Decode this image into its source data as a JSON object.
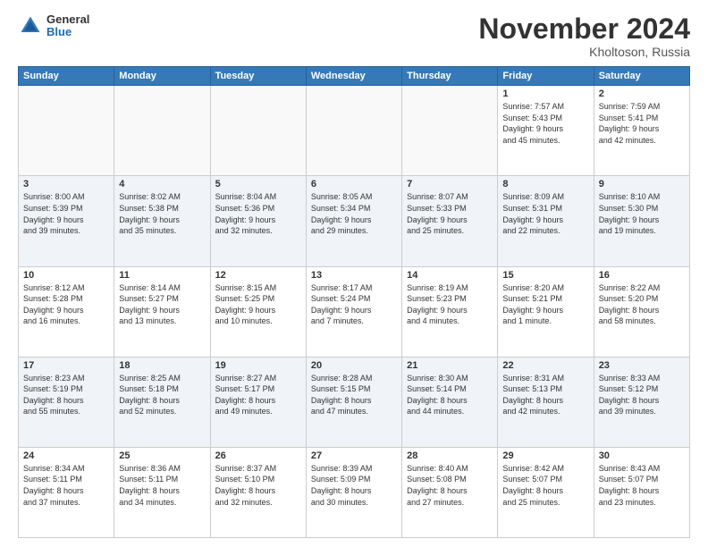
{
  "header": {
    "logo": {
      "general": "General",
      "blue": "Blue"
    },
    "title": "November 2024",
    "subtitle": "Kholtoson, Russia"
  },
  "weekdays": [
    "Sunday",
    "Monday",
    "Tuesday",
    "Wednesday",
    "Thursday",
    "Friday",
    "Saturday"
  ],
  "weeks": [
    [
      {
        "day": "",
        "info": ""
      },
      {
        "day": "",
        "info": ""
      },
      {
        "day": "",
        "info": ""
      },
      {
        "day": "",
        "info": ""
      },
      {
        "day": "",
        "info": ""
      },
      {
        "day": "1",
        "info": "Sunrise: 7:57 AM\nSunset: 5:43 PM\nDaylight: 9 hours\nand 45 minutes."
      },
      {
        "day": "2",
        "info": "Sunrise: 7:59 AM\nSunset: 5:41 PM\nDaylight: 9 hours\nand 42 minutes."
      }
    ],
    [
      {
        "day": "3",
        "info": "Sunrise: 8:00 AM\nSunset: 5:39 PM\nDaylight: 9 hours\nand 39 minutes."
      },
      {
        "day": "4",
        "info": "Sunrise: 8:02 AM\nSunset: 5:38 PM\nDaylight: 9 hours\nand 35 minutes."
      },
      {
        "day": "5",
        "info": "Sunrise: 8:04 AM\nSunset: 5:36 PM\nDaylight: 9 hours\nand 32 minutes."
      },
      {
        "day": "6",
        "info": "Sunrise: 8:05 AM\nSunset: 5:34 PM\nDaylight: 9 hours\nand 29 minutes."
      },
      {
        "day": "7",
        "info": "Sunrise: 8:07 AM\nSunset: 5:33 PM\nDaylight: 9 hours\nand 25 minutes."
      },
      {
        "day": "8",
        "info": "Sunrise: 8:09 AM\nSunset: 5:31 PM\nDaylight: 9 hours\nand 22 minutes."
      },
      {
        "day": "9",
        "info": "Sunrise: 8:10 AM\nSunset: 5:30 PM\nDaylight: 9 hours\nand 19 minutes."
      }
    ],
    [
      {
        "day": "10",
        "info": "Sunrise: 8:12 AM\nSunset: 5:28 PM\nDaylight: 9 hours\nand 16 minutes."
      },
      {
        "day": "11",
        "info": "Sunrise: 8:14 AM\nSunset: 5:27 PM\nDaylight: 9 hours\nand 13 minutes."
      },
      {
        "day": "12",
        "info": "Sunrise: 8:15 AM\nSunset: 5:25 PM\nDaylight: 9 hours\nand 10 minutes."
      },
      {
        "day": "13",
        "info": "Sunrise: 8:17 AM\nSunset: 5:24 PM\nDaylight: 9 hours\nand 7 minutes."
      },
      {
        "day": "14",
        "info": "Sunrise: 8:19 AM\nSunset: 5:23 PM\nDaylight: 9 hours\nand 4 minutes."
      },
      {
        "day": "15",
        "info": "Sunrise: 8:20 AM\nSunset: 5:21 PM\nDaylight: 9 hours\nand 1 minute."
      },
      {
        "day": "16",
        "info": "Sunrise: 8:22 AM\nSunset: 5:20 PM\nDaylight: 8 hours\nand 58 minutes."
      }
    ],
    [
      {
        "day": "17",
        "info": "Sunrise: 8:23 AM\nSunset: 5:19 PM\nDaylight: 8 hours\nand 55 minutes."
      },
      {
        "day": "18",
        "info": "Sunrise: 8:25 AM\nSunset: 5:18 PM\nDaylight: 8 hours\nand 52 minutes."
      },
      {
        "day": "19",
        "info": "Sunrise: 8:27 AM\nSunset: 5:17 PM\nDaylight: 8 hours\nand 49 minutes."
      },
      {
        "day": "20",
        "info": "Sunrise: 8:28 AM\nSunset: 5:15 PM\nDaylight: 8 hours\nand 47 minutes."
      },
      {
        "day": "21",
        "info": "Sunrise: 8:30 AM\nSunset: 5:14 PM\nDaylight: 8 hours\nand 44 minutes."
      },
      {
        "day": "22",
        "info": "Sunrise: 8:31 AM\nSunset: 5:13 PM\nDaylight: 8 hours\nand 42 minutes."
      },
      {
        "day": "23",
        "info": "Sunrise: 8:33 AM\nSunset: 5:12 PM\nDaylight: 8 hours\nand 39 minutes."
      }
    ],
    [
      {
        "day": "24",
        "info": "Sunrise: 8:34 AM\nSunset: 5:11 PM\nDaylight: 8 hours\nand 37 minutes."
      },
      {
        "day": "25",
        "info": "Sunrise: 8:36 AM\nSunset: 5:11 PM\nDaylight: 8 hours\nand 34 minutes."
      },
      {
        "day": "26",
        "info": "Sunrise: 8:37 AM\nSunset: 5:10 PM\nDaylight: 8 hours\nand 32 minutes."
      },
      {
        "day": "27",
        "info": "Sunrise: 8:39 AM\nSunset: 5:09 PM\nDaylight: 8 hours\nand 30 minutes."
      },
      {
        "day": "28",
        "info": "Sunrise: 8:40 AM\nSunset: 5:08 PM\nDaylight: 8 hours\nand 27 minutes."
      },
      {
        "day": "29",
        "info": "Sunrise: 8:42 AM\nSunset: 5:07 PM\nDaylight: 8 hours\nand 25 minutes."
      },
      {
        "day": "30",
        "info": "Sunrise: 8:43 AM\nSunset: 5:07 PM\nDaylight: 8 hours\nand 23 minutes."
      }
    ]
  ]
}
